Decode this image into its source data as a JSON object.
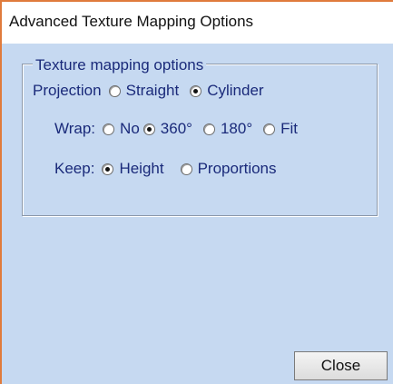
{
  "window": {
    "title": "Advanced Texture Mapping Options",
    "accent_color": "#e07b3c",
    "background_color": "#c6d9f1"
  },
  "group": {
    "legend": "Texture mapping options"
  },
  "projection": {
    "label": "Projection",
    "options": [
      {
        "label": "Straight",
        "checked": false
      },
      {
        "label": "Cylinder",
        "checked": true
      }
    ]
  },
  "wrap": {
    "label": "Wrap:",
    "options": [
      {
        "label": "No",
        "checked": false
      },
      {
        "label": "360°",
        "checked": true
      },
      {
        "label": "180°",
        "checked": false
      },
      {
        "label": "Fit",
        "checked": false
      }
    ]
  },
  "keep": {
    "label": "Keep:",
    "options": [
      {
        "label": "Height",
        "checked": true
      },
      {
        "label": "Proportions",
        "checked": false
      }
    ]
  },
  "buttons": {
    "close_label": "Close"
  }
}
